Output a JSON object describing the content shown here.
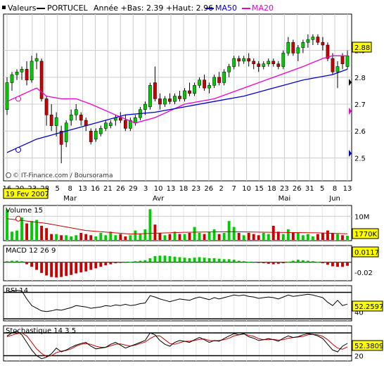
{
  "legend": {
    "label_values": "Valeurs",
    "label_symbol": "PORTUCEL",
    "label_stats": "Année +Bas: 2.39 +Haut: 2.96",
    "label_ma50": "MA50",
    "label_ma20": "MA20"
  },
  "colors": {
    "up": "#00cc00",
    "down": "#cc0000",
    "ma50": "#0000cc",
    "ma20": "#ee00cc",
    "ma_volume": "#cc0000",
    "grid": "#cccccc",
    "current_box": "#ffff00"
  },
  "copyright": "© IT-Finance.com / Boursorama",
  "start_date_label": "19 Fev 2007",
  "x_axis": {
    "day_labels": [
      "16",
      "20",
      "23",
      "28",
      "5",
      "8",
      "13",
      "16",
      "21",
      "26",
      "29",
      "3",
      "10",
      "13",
      "18",
      "23",
      "26",
      "2",
      "7",
      "10",
      "15",
      "18",
      "23",
      "26",
      "31",
      "5",
      "8",
      "13"
    ],
    "month_labels": [
      {
        "label": "Mar",
        "at_day_index": 5
      },
      {
        "label": "Avr",
        "at_day_index": 12
      },
      {
        "label": "Mai",
        "at_day_index": 22
      },
      {
        "label": "Jun",
        "at_day_index": 26
      }
    ]
  },
  "chart_data": [
    {
      "type": "candlestick",
      "name": "price",
      "ylim": [
        2.42,
        3.03
      ],
      "yticks": [
        "2.5",
        "2.6",
        "2.7",
        "2.8",
        "2.9"
      ],
      "current_value": "2.88",
      "candles": [
        {
          "o": 2.68,
          "h": 2.8,
          "l": 2.66,
          "c": 2.78
        },
        {
          "o": 2.78,
          "h": 2.82,
          "l": 2.75,
          "c": 2.81
        },
        {
          "o": 2.81,
          "h": 2.83,
          "l": 2.79,
          "c": 2.82
        },
        {
          "o": 2.82,
          "h": 2.84,
          "l": 2.79,
          "c": 2.83
        },
        {
          "o": 2.83,
          "h": 2.86,
          "l": 2.77,
          "c": 2.79
        },
        {
          "o": 2.79,
          "h": 2.88,
          "l": 2.78,
          "c": 2.86
        },
        {
          "o": 2.86,
          "h": 2.89,
          "l": 2.83,
          "c": 2.87
        },
        {
          "o": 2.86,
          "h": 2.87,
          "l": 2.71,
          "c": 2.72
        },
        {
          "o": 2.72,
          "h": 2.73,
          "l": 2.62,
          "c": 2.66
        },
        {
          "o": 2.66,
          "h": 2.7,
          "l": 2.6,
          "c": 2.62
        },
        {
          "o": 2.62,
          "h": 2.67,
          "l": 2.58,
          "c": 2.65
        },
        {
          "o": 2.6,
          "h": 2.62,
          "l": 2.48,
          "c": 2.55
        },
        {
          "o": 2.56,
          "h": 2.64,
          "l": 2.54,
          "c": 2.63
        },
        {
          "o": 2.64,
          "h": 2.68,
          "l": 2.62,
          "c": 2.66
        },
        {
          "o": 2.66,
          "h": 2.7,
          "l": 2.64,
          "c": 2.68
        },
        {
          "o": 2.66,
          "h": 2.67,
          "l": 2.62,
          "c": 2.64
        },
        {
          "o": 2.64,
          "h": 2.65,
          "l": 2.6,
          "c": 2.62
        },
        {
          "o": 2.6,
          "h": 2.61,
          "l": 2.55,
          "c": 2.56
        },
        {
          "o": 2.57,
          "h": 2.61,
          "l": 2.56,
          "c": 2.6
        },
        {
          "o": 2.59,
          "h": 2.62,
          "l": 2.58,
          "c": 2.61
        },
        {
          "o": 2.61,
          "h": 2.64,
          "l": 2.6,
          "c": 2.63
        },
        {
          "o": 2.62,
          "h": 2.64,
          "l": 2.61,
          "c": 2.63
        },
        {
          "o": 2.64,
          "h": 2.66,
          "l": 2.62,
          "c": 2.65
        },
        {
          "o": 2.65,
          "h": 2.67,
          "l": 2.63,
          "c": 2.64
        },
        {
          "o": 2.64,
          "h": 2.66,
          "l": 2.6,
          "c": 2.61
        },
        {
          "o": 2.61,
          "h": 2.65,
          "l": 2.6,
          "c": 2.64
        },
        {
          "o": 2.63,
          "h": 2.66,
          "l": 2.62,
          "c": 2.65
        },
        {
          "o": 2.65,
          "h": 2.69,
          "l": 2.64,
          "c": 2.68
        },
        {
          "o": 2.68,
          "h": 2.71,
          "l": 2.66,
          "c": 2.7
        },
        {
          "o": 2.69,
          "h": 2.78,
          "l": 2.68,
          "c": 2.77
        },
        {
          "o": 2.78,
          "h": 2.84,
          "l": 2.71,
          "c": 2.72
        },
        {
          "o": 2.72,
          "h": 2.74,
          "l": 2.68,
          "c": 2.7
        },
        {
          "o": 2.7,
          "h": 2.73,
          "l": 2.69,
          "c": 2.72
        },
        {
          "o": 2.72,
          "h": 2.74,
          "l": 2.7,
          "c": 2.71
        },
        {
          "o": 2.71,
          "h": 2.74,
          "l": 2.7,
          "c": 2.73
        },
        {
          "o": 2.73,
          "h": 2.75,
          "l": 2.71,
          "c": 2.72
        },
        {
          "o": 2.72,
          "h": 2.76,
          "l": 2.71,
          "c": 2.75
        },
        {
          "o": 2.75,
          "h": 2.78,
          "l": 2.73,
          "c": 2.74
        },
        {
          "o": 2.74,
          "h": 2.78,
          "l": 2.73,
          "c": 2.77
        },
        {
          "o": 2.77,
          "h": 2.8,
          "l": 2.76,
          "c": 2.79
        },
        {
          "o": 2.79,
          "h": 2.81,
          "l": 2.75,
          "c": 2.76
        },
        {
          "o": 2.76,
          "h": 2.78,
          "l": 2.74,
          "c": 2.77
        },
        {
          "o": 2.77,
          "h": 2.81,
          "l": 2.76,
          "c": 2.8
        },
        {
          "o": 2.8,
          "h": 2.82,
          "l": 2.77,
          "c": 2.78
        },
        {
          "o": 2.78,
          "h": 2.83,
          "l": 2.77,
          "c": 2.82
        },
        {
          "o": 2.82,
          "h": 2.85,
          "l": 2.8,
          "c": 2.84
        },
        {
          "o": 2.84,
          "h": 2.88,
          "l": 2.83,
          "c": 2.87
        },
        {
          "o": 2.87,
          "h": 2.88,
          "l": 2.84,
          "c": 2.86
        },
        {
          "o": 2.86,
          "h": 2.88,
          "l": 2.85,
          "c": 2.87
        },
        {
          "o": 2.87,
          "h": 2.89,
          "l": 2.84,
          "c": 2.86
        },
        {
          "o": 2.86,
          "h": 2.87,
          "l": 2.83,
          "c": 2.85
        },
        {
          "o": 2.85,
          "h": 2.86,
          "l": 2.82,
          "c": 2.84
        },
        {
          "o": 2.84,
          "h": 2.86,
          "l": 2.83,
          "c": 2.85
        },
        {
          "o": 2.85,
          "h": 2.87,
          "l": 2.84,
          "c": 2.86
        },
        {
          "o": 2.86,
          "h": 2.87,
          "l": 2.84,
          "c": 2.85
        },
        {
          "o": 2.85,
          "h": 2.86,
          "l": 2.83,
          "c": 2.84
        },
        {
          "o": 2.84,
          "h": 2.9,
          "l": 2.83,
          "c": 2.89
        },
        {
          "o": 2.89,
          "h": 2.95,
          "l": 2.88,
          "c": 2.93
        },
        {
          "o": 2.93,
          "h": 2.94,
          "l": 2.88,
          "c": 2.89
        },
        {
          "o": 2.89,
          "h": 2.92,
          "l": 2.86,
          "c": 2.91
        },
        {
          "o": 2.91,
          "h": 2.94,
          "l": 2.89,
          "c": 2.93
        },
        {
          "o": 2.93,
          "h": 2.96,
          "l": 2.91,
          "c": 2.94
        },
        {
          "o": 2.94,
          "h": 2.96,
          "l": 2.92,
          "c": 2.95
        },
        {
          "o": 2.95,
          "h": 2.96,
          "l": 2.92,
          "c": 2.93
        },
        {
          "o": 2.93,
          "h": 2.95,
          "l": 2.9,
          "c": 2.92
        },
        {
          "o": 2.92,
          "h": 2.93,
          "l": 2.86,
          "c": 2.87
        },
        {
          "o": 2.87,
          "h": 2.89,
          "l": 2.81,
          "c": 2.82
        },
        {
          "o": 2.82,
          "h": 2.86,
          "l": 2.76,
          "c": 2.84
        },
        {
          "o": 2.88,
          "h": 2.89,
          "l": 2.83,
          "c": 2.85
        },
        {
          "o": 2.84,
          "h": 2.9,
          "l": 2.83,
          "c": 2.88
        }
      ],
      "ma20": [
        {
          "i": 0,
          "v": 2.71
        },
        {
          "i": 6,
          "v": 2.76
        },
        {
          "i": 8,
          "v": 2.73
        },
        {
          "i": 11,
          "v": 2.72
        },
        {
          "i": 14,
          "v": 2.72
        },
        {
          "i": 17,
          "v": 2.7
        },
        {
          "i": 22,
          "v": 2.66
        },
        {
          "i": 26,
          "v": 2.63
        },
        {
          "i": 30,
          "v": 2.65
        },
        {
          "i": 36,
          "v": 2.7
        },
        {
          "i": 42,
          "v": 2.72
        },
        {
          "i": 48,
          "v": 2.76
        },
        {
          "i": 54,
          "v": 2.8
        },
        {
          "i": 60,
          "v": 2.84
        },
        {
          "i": 64,
          "v": 2.87
        },
        {
          "i": 66,
          "v": 2.88
        },
        {
          "i": 69,
          "v": 2.88
        }
      ],
      "ma50": [
        {
          "i": 0,
          "v": 2.52
        },
        {
          "i": 6,
          "v": 2.57
        },
        {
          "i": 12,
          "v": 2.6
        },
        {
          "i": 18,
          "v": 2.63
        },
        {
          "i": 24,
          "v": 2.66
        },
        {
          "i": 30,
          "v": 2.67
        },
        {
          "i": 36,
          "v": 2.69
        },
        {
          "i": 42,
          "v": 2.71
        },
        {
          "i": 48,
          "v": 2.73
        },
        {
          "i": 54,
          "v": 2.76
        },
        {
          "i": 60,
          "v": 2.79
        },
        {
          "i": 66,
          "v": 2.81
        },
        {
          "i": 69,
          "v": 2.83
        }
      ]
    },
    {
      "type": "bar",
      "name": "volume",
      "title": "Volume 15",
      "yticks": [
        "10M"
      ],
      "ylim": [
        0,
        14000000
      ],
      "current_value": "1770K",
      "values": [
        13000000,
        3500000,
        4000000,
        9500000,
        7000000,
        8000000,
        8500000,
        6000000,
        5000000,
        2500000,
        2500000,
        2000000,
        2000000,
        1500000,
        2000000,
        3000000,
        2500000,
        2000000,
        1500000,
        3000000,
        2000000,
        3500000,
        2000000,
        2500000,
        1500000,
        2000000,
        4000000,
        2500000,
        4500000,
        13000000,
        6500000,
        3000000,
        2000000,
        2500000,
        3500000,
        2500000,
        2500000,
        3000000,
        5500000,
        3000000,
        2500000,
        3500000,
        4500000,
        2500000,
        3000000,
        8000000,
        5500000,
        3000000,
        2000000,
        3000000,
        2500000,
        2000000,
        3000000,
        2500000,
        6000000,
        3500000,
        2500000,
        4500000,
        3000000,
        3000000,
        2000000,
        2500000,
        1500000,
        2500000,
        3000000,
        4000000,
        3000000,
        2500000,
        2000000,
        1770000
      ],
      "ma": [
        {
          "i": 0,
          "v": 9000000
        },
        {
          "i": 8,
          "v": 7000000
        },
        {
          "i": 16,
          "v": 4000000
        },
        {
          "i": 25,
          "v": 2500000
        },
        {
          "i": 35,
          "v": 3200000
        },
        {
          "i": 45,
          "v": 3500000
        },
        {
          "i": 55,
          "v": 3200000
        },
        {
          "i": 63,
          "v": 3000000
        },
        {
          "i": 69,
          "v": 2600000
        }
      ]
    },
    {
      "type": "histogram",
      "name": "macd",
      "title": "MACD 12 26 9",
      "yticks": [
        "-0.02"
      ],
      "ylim": [
        -0.035,
        0.03
      ],
      "current_value": "0.0117",
      "values": [
        0.002,
        0.003,
        0.003,
        0.002,
        -0.004,
        -0.009,
        -0.015,
        -0.021,
        -0.026,
        -0.029,
        -0.03,
        -0.029,
        -0.027,
        -0.025,
        -0.022,
        -0.02,
        -0.018,
        -0.015,
        -0.012,
        -0.009,
        -0.006,
        -0.004,
        -0.002,
        -0.001,
        0.0,
        0.001,
        0.002,
        0.003,
        0.004,
        0.008,
        0.012,
        0.013,
        0.013,
        0.012,
        0.011,
        0.01,
        0.009,
        0.008,
        0.009,
        0.01,
        0.009,
        0.008,
        0.008,
        0.007,
        0.006,
        0.006,
        0.005,
        0.003,
        0.002,
        0.001,
        0.0,
        -0.001,
        -0.002,
        -0.003,
        -0.004,
        -0.003,
        -0.002,
        0.001,
        0.003,
        0.005,
        0.004,
        0.003,
        0.002,
        0.001,
        -0.002,
        -0.005,
        -0.008,
        -0.009,
        -0.009,
        -0.007
      ]
    },
    {
      "type": "line",
      "name": "rsi",
      "title": "RSI 14",
      "yticks": [
        "40"
      ],
      "ylim": [
        28,
        78
      ],
      "current_value": "52.2597",
      "values": [
        70,
        72,
        73,
        72,
        60,
        50,
        46,
        42,
        41,
        42,
        44,
        43,
        45,
        47,
        50,
        49,
        48,
        46,
        47,
        48,
        50,
        49,
        51,
        50,
        52,
        50,
        51,
        53,
        54,
        65,
        63,
        60,
        58,
        56,
        58,
        60,
        59,
        58,
        61,
        63,
        61,
        59,
        62,
        60,
        62,
        64,
        66,
        65,
        66,
        64,
        63,
        61,
        62,
        63,
        62,
        60,
        63,
        66,
        64,
        65,
        66,
        67,
        66,
        64,
        62,
        55,
        50,
        58,
        50,
        52.26
      ]
    },
    {
      "type": "line",
      "name": "stochastic",
      "title": "Stochastique 14 3 5",
      "yticks": [
        "20"
      ],
      "ylim": [
        8,
        95
      ],
      "current_value": "52.3809",
      "k": [
        72,
        80,
        85,
        75,
        55,
        35,
        20,
        12,
        16,
        25,
        40,
        30,
        35,
        42,
        48,
        52,
        55,
        45,
        38,
        40,
        42,
        50,
        55,
        48,
        40,
        45,
        50,
        55,
        60,
        80,
        75,
        60,
        50,
        45,
        55,
        60,
        58,
        55,
        62,
        68,
        62,
        55,
        60,
        58,
        65,
        72,
        78,
        75,
        78,
        70,
        66,
        60,
        62,
        65,
        62,
        58,
        66,
        72,
        68,
        70,
        75,
        78,
        76,
        72,
        65,
        50,
        35,
        30,
        45,
        52.38
      ],
      "d": [
        70,
        74,
        78,
        80,
        72,
        55,
        38,
        26,
        18,
        20,
        28,
        32,
        34,
        38,
        45,
        50,
        52,
        50,
        45,
        42,
        42,
        46,
        50,
        51,
        48,
        45,
        48,
        52,
        56,
        65,
        72,
        72,
        62,
        52,
        50,
        54,
        58,
        58,
        60,
        63,
        64,
        60,
        59,
        60,
        62,
        66,
        72,
        75,
        77,
        74,
        71,
        65,
        62,
        62,
        63,
        61,
        62,
        66,
        68,
        69,
        71,
        75,
        76,
        75,
        71,
        62,
        50,
        40,
        37,
        43
      ]
    }
  ]
}
